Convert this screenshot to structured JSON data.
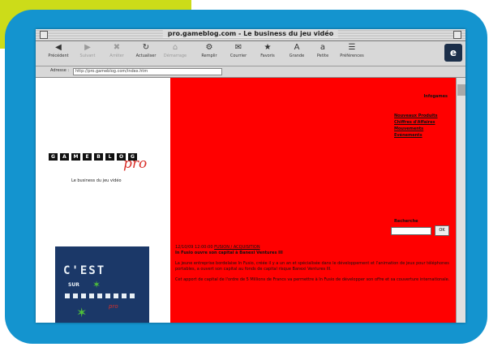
{
  "window": {
    "title": "pro.gameblog.com - Le business du jeu vidéo"
  },
  "toolbar": {
    "buttons": [
      {
        "glyph": "◀",
        "label": "Précédent",
        "dim": false
      },
      {
        "glyph": "▶",
        "label": "Suivant",
        "dim": true
      },
      {
        "glyph": "✖",
        "label": "Arrêter",
        "dim": true
      },
      {
        "glyph": "↻",
        "label": "Actualiser",
        "dim": false
      },
      {
        "glyph": "⌂",
        "label": "Démarrage",
        "dim": true
      },
      {
        "glyph": "⚙",
        "label": "Remplir",
        "dim": false
      },
      {
        "glyph": "✉",
        "label": "Courrier",
        "dim": false
      },
      {
        "glyph": "★",
        "label": "Favoris",
        "dim": false
      },
      {
        "glyph": "A",
        "label": "Grande",
        "dim": false
      },
      {
        "glyph": "a",
        "label": "Petite",
        "dim": false
      },
      {
        "glyph": "☰",
        "label": "Préférences",
        "dim": false
      }
    ]
  },
  "address": {
    "label": "Adresse :",
    "url": "http://pro.gameblog.com/index.htm"
  },
  "left": {
    "logo_letters": [
      "G",
      "A",
      "M",
      "E",
      "B",
      "L",
      "O",
      "G"
    ],
    "logo_sub": "pro",
    "tagline": "Le business du jeu vidéo",
    "promo": {
      "line1": "C'EST",
      "line2": "SUR",
      "sub": "pro"
    }
  },
  "right": {
    "info_label": "Infogames",
    "links": [
      "Nouveaux Produits",
      "Chiffres d'Affaires",
      "Mouvements",
      "Evénements"
    ],
    "search_label": "Recherche",
    "search_button": "OK",
    "article": {
      "date": "12/10/09 12:00:00",
      "category": "FUSION / ACQUISITION",
      "headline": "In Fusio ouvre son capital à Banexi Ventures III",
      "p1": "La jeune entreprise bordelaise In Fusio, créée il y a un an et spécialisée dans le développement et l'animation de jeux pour téléphones portables, a ouvert son capital au fonds de capital risque Banexi Ventures III.",
      "p2": "Cet apport de capital de l'ordre de 5 Millions de Francs va permettre à In Fusio de développer son offre et sa couverture internationale."
    }
  },
  "colors": {
    "page_bg": "#ff0000",
    "blue_frame": "#1494cf",
    "yellow_corner": "#ccdc19"
  }
}
